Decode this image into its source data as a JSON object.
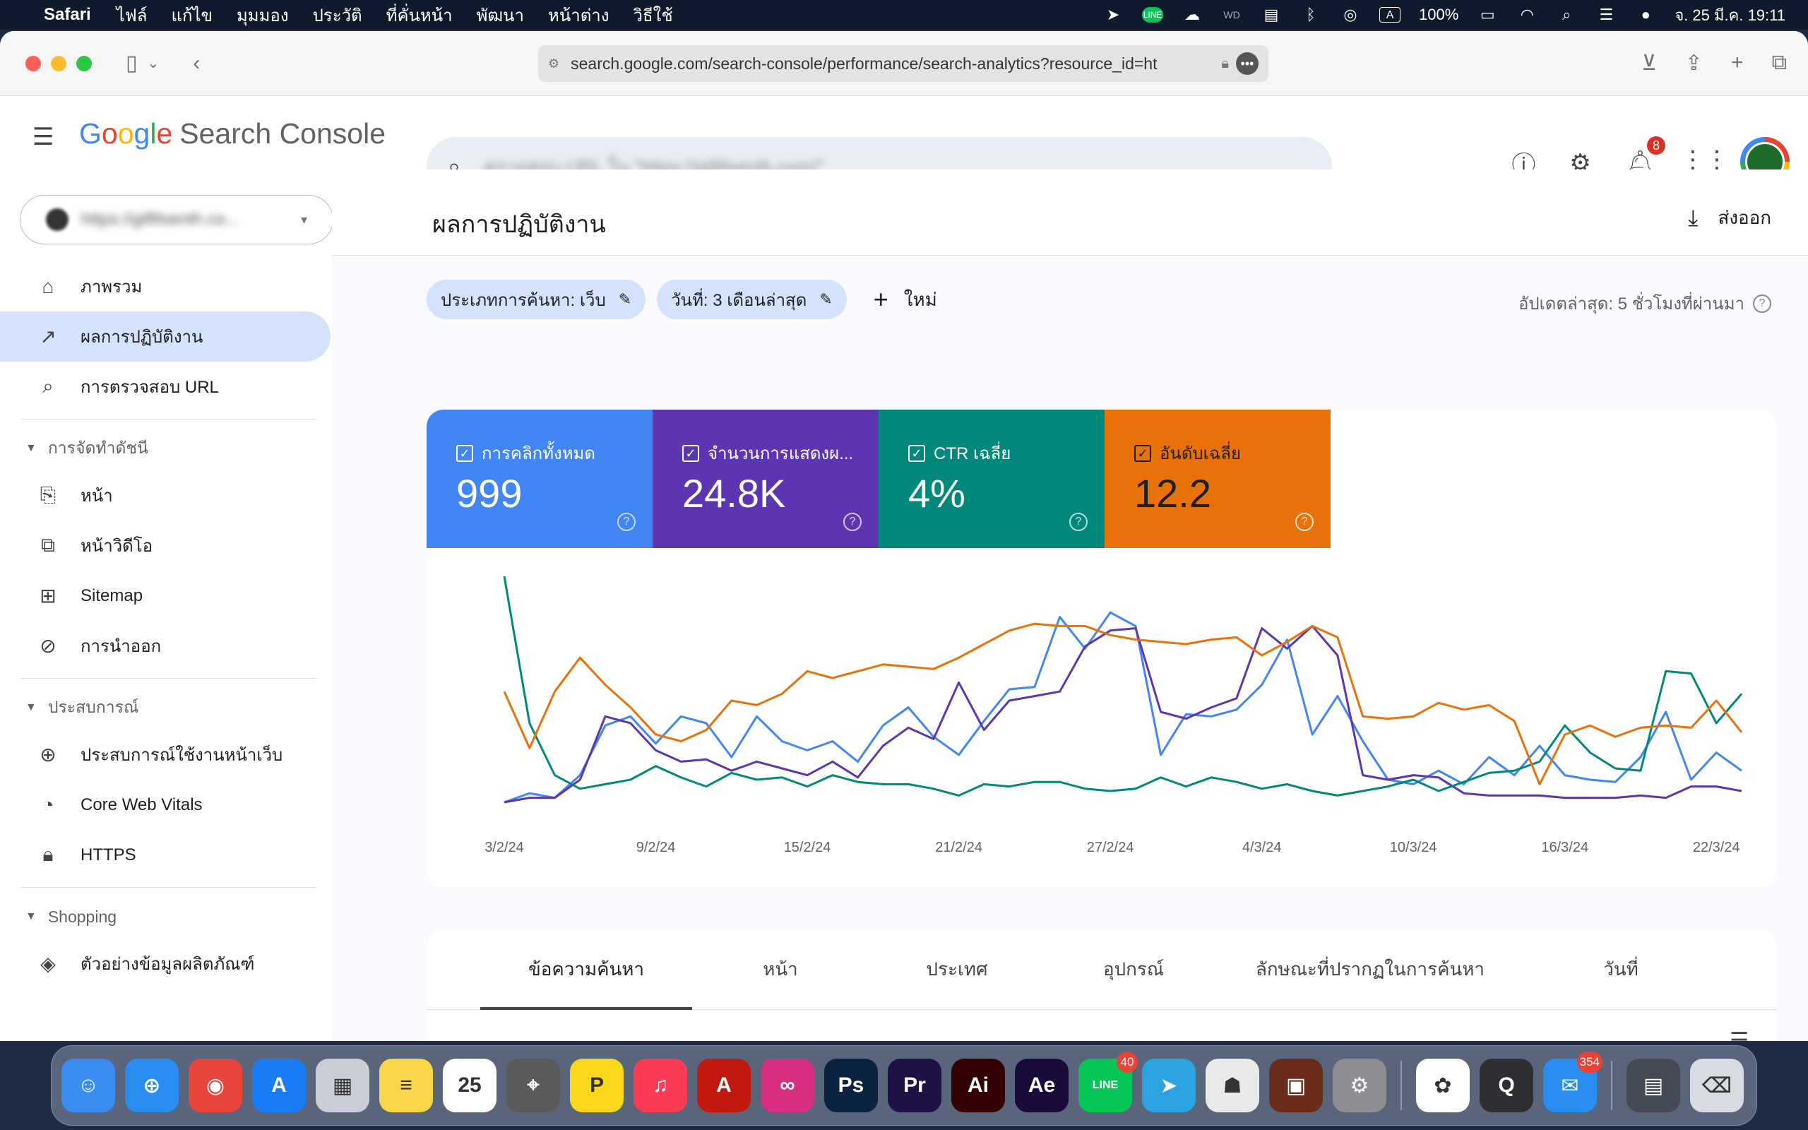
{
  "menubar": {
    "app_name": "Safari",
    "items": [
      "ไฟล์",
      "แก้ไข",
      "มุมมอง",
      "ประวัติ",
      "ที่คั่นหน้า",
      "พัฒนา",
      "หน้าต่าง",
      "วิธีใช้"
    ],
    "battery": "100%",
    "datetime": "จ. 25 มี.ค.  19:11"
  },
  "browser": {
    "url": "search.google.com/search-console/performance/search-analytics?resource_id=ht"
  },
  "header": {
    "logo_word": [
      "G",
      "o",
      "o",
      "g",
      "l",
      "e"
    ],
    "product": "Search Console",
    "search_placeholder": "ตรวจสอบ URL ใน \"https://gilfilsenth.com/\"",
    "notification_count": "8"
  },
  "sidebar": {
    "property": "https://gilfilsenth.co...",
    "items_top": [
      {
        "label": "ภาพรวม",
        "icon": "home-icon"
      },
      {
        "label": "ผลการปฏิบัติงาน",
        "icon": "trending-up-icon"
      },
      {
        "label": "การตรวจสอบ URL",
        "icon": "search-icon"
      }
    ],
    "group_index": "การจัดทำดัชนี",
    "items_index": [
      {
        "label": "หน้า",
        "icon": "pages-icon"
      },
      {
        "label": "หน้าวิดีโอ",
        "icon": "video-pages-icon"
      },
      {
        "label": "Sitemap",
        "icon": "sitemap-icon"
      },
      {
        "label": "การนำออก",
        "icon": "removal-icon"
      }
    ],
    "group_experience": "ประสบการณ์",
    "items_experience": [
      {
        "label": "ประสบการณ์ใช้งานหน้าเว็บ",
        "icon": "page-experience-icon"
      },
      {
        "label": "Core Web Vitals",
        "icon": "speed-gauge-icon"
      },
      {
        "label": "HTTPS",
        "icon": "lock-icon"
      }
    ],
    "group_shopping": "Shopping",
    "items_shopping": [
      {
        "label": "ตัวอย่างข้อมูลผลิตภัณฑ์",
        "icon": "product-layers-icon"
      }
    ]
  },
  "main": {
    "title": "ผลการปฏิบัติงาน",
    "export_label": "ส่งออก",
    "filter_search_type": "ประเภทการค้นหา: เว็บ",
    "filter_date": "วันที่: 3 เดือนล่าสุด",
    "new_label": "ใหม่",
    "updated_label": "อัปเดตล่าสุด: 5 ชั่วโมงที่ผ่านมา"
  },
  "metrics": [
    {
      "label": "การคลิกทั้งหมด",
      "value": "999",
      "color": "#4285f4"
    },
    {
      "label": "จำนวนการแสดงผ...",
      "value": "24.8K",
      "color": "#5e35b1"
    },
    {
      "label": "CTR เฉลี่ย",
      "value": "4%",
      "color": "#00897b"
    },
    {
      "label": "อันดับเฉลี่ย",
      "value": "12.2",
      "color": "#e8710a"
    }
  ],
  "chart_data": {
    "type": "line",
    "x_ticks": [
      "3/2/24",
      "9/2/24",
      "15/2/24",
      "21/2/24",
      "27/2/24",
      "4/3/24",
      "10/3/24",
      "16/3/24",
      "22/3/24"
    ],
    "x": [
      "3/2/24",
      "4/2/24",
      "5/2/24",
      "6/2/24",
      "7/2/24",
      "8/2/24",
      "9/2/24",
      "10/2/24",
      "11/2/24",
      "12/2/24",
      "13/2/24",
      "14/2/24",
      "15/2/24",
      "16/2/24",
      "17/2/24",
      "18/2/24",
      "19/2/24",
      "20/2/24",
      "21/2/24",
      "22/2/24",
      "23/2/24",
      "24/2/24",
      "25/2/24",
      "26/2/24",
      "27/2/24",
      "28/2/24",
      "29/2/24",
      "1/3/24",
      "2/3/24",
      "3/3/24",
      "4/3/24",
      "5/3/24",
      "6/3/24",
      "7/3/24",
      "8/3/24",
      "9/3/24",
      "10/3/24",
      "11/3/24",
      "12/3/24",
      "13/3/24",
      "14/3/24",
      "15/3/24",
      "16/3/24",
      "17/3/24",
      "18/3/24",
      "19/3/24",
      "20/3/24",
      "21/3/24",
      "22/3/24",
      "23/3/24"
    ],
    "series": [
      {
        "name": "การคลิกทั้งหมด",
        "color": "#4285f4",
        "values": [
          0,
          4,
          2,
          12,
          34,
          38,
          26,
          38,
          35,
          20,
          38,
          27,
          23,
          27,
          18,
          34,
          42,
          29,
          21,
          36,
          50,
          51,
          82,
          68,
          84,
          78,
          21,
          39,
          38,
          41,
          52,
          72,
          30,
          47,
          27,
          10,
          8,
          14,
          8,
          20,
          12,
          25,
          12,
          10,
          9,
          20,
          40,
          10,
          22,
          14
        ]
      },
      {
        "name": "จำนวนการแสดงผล",
        "color": "#5e35b1",
        "values": [
          0,
          2,
          2,
          10,
          38,
          35,
          23,
          18,
          19,
          14,
          18,
          15,
          12,
          18,
          11,
          25,
          33,
          28,
          53,
          32,
          45,
          47,
          49,
          69,
          76,
          77,
          40,
          37,
          42,
          46,
          77,
          68,
          78,
          65,
          12,
          10,
          12,
          11,
          4,
          3,
          3,
          3,
          2,
          2,
          2,
          3,
          2,
          7,
          7,
          5
        ]
      },
      {
        "name": "CTR เฉลี่ย",
        "color": "#00897b",
        "values": [
          100,
          35,
          12,
          6,
          8,
          10,
          16,
          11,
          7,
          13,
          10,
          11,
          7,
          12,
          9,
          8,
          8,
          6,
          3,
          8,
          7,
          9,
          9,
          6,
          5,
          6,
          11,
          7,
          11,
          9,
          6,
          8,
          5,
          3,
          5,
          7,
          10,
          5,
          9,
          13,
          14,
          18,
          34,
          22,
          15,
          14,
          58,
          57,
          35,
          48
        ]
      },
      {
        "name": "อันดับเฉลี่ย",
        "color": "#e8710a",
        "values": [
          49,
          24,
          49,
          64,
          52,
          42,
          30,
          27,
          32,
          45,
          43,
          48,
          58,
          55,
          58,
          61,
          60,
          59,
          64,
          70,
          76,
          79,
          78,
          78,
          74,
          72,
          71,
          70,
          72,
          73,
          65,
          71,
          78,
          73,
          38,
          37,
          38,
          44,
          41,
          43,
          36,
          8,
          30,
          34,
          29,
          33,
          34,
          33,
          45,
          31
        ]
      }
    ],
    "grid": false,
    "legend": "none"
  },
  "tabs": [
    "ข้อความค้นหา",
    "หน้า",
    "ประเทศ",
    "อุปกรณ์",
    "ลักษณะที่ปรากฏในการค้นหา",
    "วันที่"
  ],
  "dock": [
    {
      "name": "finder",
      "color": "#3b8cf2",
      "glyph": "☺",
      "badge": ""
    },
    {
      "name": "safari",
      "color": "#2a8ef0",
      "glyph": "⊕",
      "badge": ""
    },
    {
      "name": "chrome",
      "color": "#e8453c",
      "glyph": "◉",
      "badge": ""
    },
    {
      "name": "app-store",
      "color": "#1a7cf5",
      "glyph": "A",
      "badge": ""
    },
    {
      "name": "launchpad",
      "color": "#c9cdd6",
      "glyph": "▦",
      "badge": ""
    },
    {
      "name": "notes",
      "color": "#f7d64a",
      "glyph": "≡",
      "badge": ""
    },
    {
      "name": "calendar",
      "color": "#ffffff",
      "glyph": "25",
      "badge": ""
    },
    {
      "name": "screenshot",
      "color": "#5a5a5a",
      "glyph": "⌖",
      "badge": ""
    },
    {
      "name": "post-it",
      "color": "#f9d71c",
      "glyph": "P",
      "badge": ""
    },
    {
      "name": "music",
      "color": "#fb3c55",
      "glyph": "♫",
      "badge": ""
    },
    {
      "name": "acrobat",
      "color": "#c1180f",
      "glyph": "A",
      "badge": ""
    },
    {
      "name": "creative-cloud",
      "color": "#d72e7d",
      "glyph": "∞",
      "badge": ""
    },
    {
      "name": "photoshop",
      "color": "#0c2340",
      "glyph": "Ps",
      "badge": ""
    },
    {
      "name": "premiere",
      "color": "#1d1146",
      "glyph": "Pr",
      "badge": ""
    },
    {
      "name": "illustrator",
      "color": "#330000",
      "glyph": "Ai",
      "badge": ""
    },
    {
      "name": "after-effects",
      "color": "#1a0b3b",
      "glyph": "Ae",
      "badge": ""
    },
    {
      "name": "line",
      "color": "#06c755",
      "glyph": "LINE",
      "badge": "40"
    },
    {
      "name": "telegram",
      "color": "#2aa3e0",
      "glyph": "➤",
      "badge": ""
    },
    {
      "name": "voice",
      "color": "#e9e9e9",
      "glyph": "☗",
      "badge": ""
    },
    {
      "name": "photo-booth",
      "color": "#6b2b1b",
      "glyph": "▣",
      "badge": ""
    },
    {
      "name": "system-settings",
      "color": "#8d8d93",
      "glyph": "⚙",
      "badge": ""
    },
    {
      "name": "photos",
      "color": "#ffffff",
      "glyph": "✿",
      "badge": ""
    },
    {
      "name": "quicktime",
      "color": "#2f2f33",
      "glyph": "Q",
      "badge": ""
    },
    {
      "name": "mail",
      "color": "#2a8ef0",
      "glyph": "✉",
      "badge": "354"
    },
    {
      "name": "folder-stack",
      "color": "#444a55",
      "glyph": "▤",
      "badge": ""
    },
    {
      "name": "trash",
      "color": "#d7dbe2",
      "glyph": "⌫",
      "badge": ""
    }
  ]
}
